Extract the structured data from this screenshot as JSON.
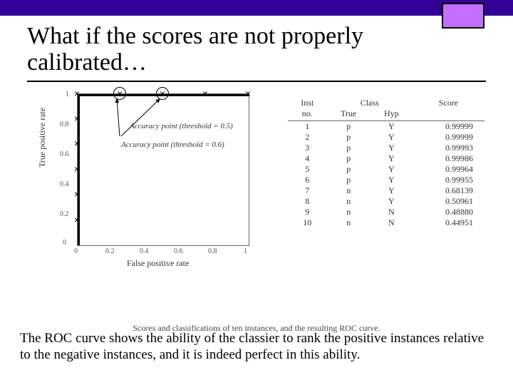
{
  "slide": {
    "title": "What if the scores are not properly calibrated…",
    "caption": "Scores and classifications of ten instances, and the resulting ROC curve.",
    "bottom_text": "The ROC curve shows the ability of the classier to rank the positive instances relative to the negative instances, and it is indeed perfect in this ability."
  },
  "chart_data": {
    "type": "line",
    "title": "",
    "xlabel": "False positive rate",
    "ylabel": "True positive rate",
    "xlim": [
      0,
      1
    ],
    "ylim": [
      0,
      1
    ],
    "xticks": [
      0,
      0.2,
      0.4,
      0.6,
      0.8,
      1
    ],
    "yticks": [
      0,
      0.2,
      0.4,
      0.6,
      0.8,
      1
    ],
    "roc_points": [
      {
        "fpr": 0.0,
        "tpr": 0.0
      },
      {
        "fpr": 0.0,
        "tpr": 1.0
      },
      {
        "fpr": 1.0,
        "tpr": 1.0
      }
    ],
    "marks": [
      {
        "fpr": 0.0,
        "tpr": 0.167
      },
      {
        "fpr": 0.0,
        "tpr": 0.333
      },
      {
        "fpr": 0.0,
        "tpr": 0.5
      },
      {
        "fpr": 0.0,
        "tpr": 0.667
      },
      {
        "fpr": 0.0,
        "tpr": 0.833
      },
      {
        "fpr": 0.0,
        "tpr": 1.0
      },
      {
        "fpr": 0.25,
        "tpr": 1.0,
        "highlight": true,
        "label": "Accuracy point (threshold = 0.6)"
      },
      {
        "fpr": 0.5,
        "tpr": 1.0,
        "highlight": true,
        "label": "Accuracy point (threshold = 0.5)"
      },
      {
        "fpr": 0.75,
        "tpr": 1.0
      },
      {
        "fpr": 1.0,
        "tpr": 1.0
      }
    ],
    "annotations": {
      "a1": "Accuracy point (threshold = 0.5)",
      "a2": "Accuracy point (threshold = 0.6)"
    }
  },
  "table": {
    "headers": {
      "inst": "Inst",
      "no": "no.",
      "class": "Class",
      "true": "True",
      "hyp": "Hyp",
      "score": "Score"
    },
    "rows": [
      {
        "no": "1",
        "true": "p",
        "hyp": "Y",
        "score": "0.99999"
      },
      {
        "no": "2",
        "true": "p",
        "hyp": "Y",
        "score": "0.99999"
      },
      {
        "no": "3",
        "true": "p",
        "hyp": "Y",
        "score": "0.99993"
      },
      {
        "no": "4",
        "true": "p",
        "hyp": "Y",
        "score": "0.99986"
      },
      {
        "no": "5",
        "true": "p",
        "hyp": "Y",
        "score": "0.99964"
      },
      {
        "no": "6",
        "true": "p",
        "hyp": "Y",
        "score": "0.99955"
      },
      {
        "no": "7",
        "true": "n",
        "hyp": "Y",
        "score": "0.68139"
      },
      {
        "no": "8",
        "true": "n",
        "hyp": "Y",
        "score": "0.50961"
      },
      {
        "no": "9",
        "true": "n",
        "hyp": "N",
        "score": "0.48880"
      },
      {
        "no": "10",
        "true": "n",
        "hyp": "N",
        "score": "0.44951"
      }
    ]
  }
}
